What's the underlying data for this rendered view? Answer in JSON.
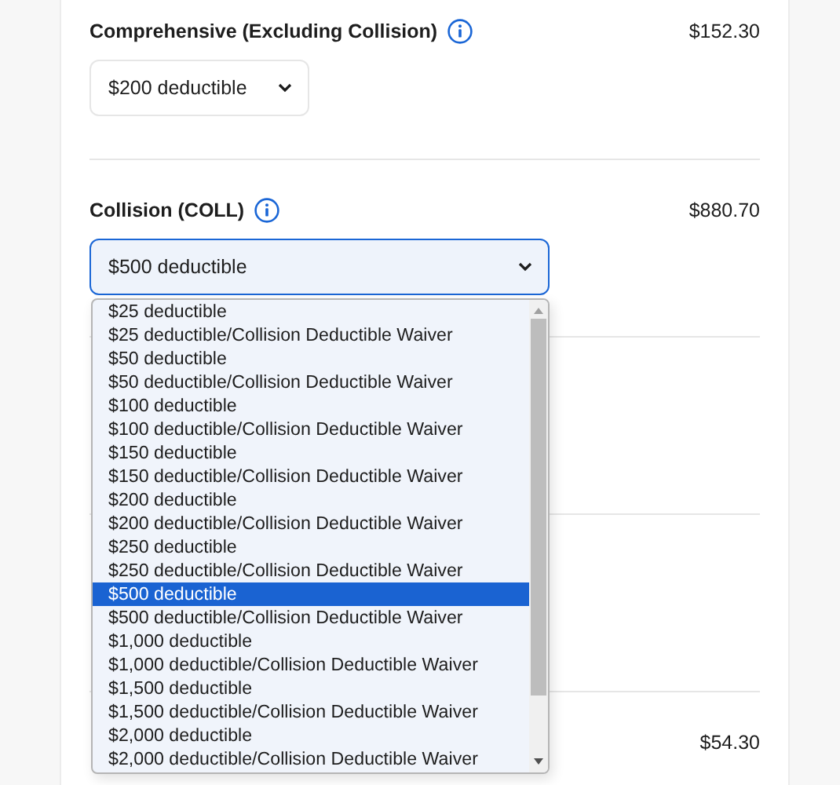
{
  "coverages": [
    {
      "title": "Comprehensive (Excluding Collision)",
      "price": "$152.30",
      "select": {
        "value": "$200 deductible",
        "open": false
      }
    },
    {
      "title": "Collision (COLL)",
      "price": "$880.70",
      "select": {
        "value": "$500 deductible",
        "open": true,
        "options": [
          {
            "label": "$25 deductible",
            "selected": false
          },
          {
            "label": "$25 deductible/Collision Deductible Waiver",
            "selected": false
          },
          {
            "label": "$50 deductible",
            "selected": false
          },
          {
            "label": "$50 deductible/Collision Deductible Waiver",
            "selected": false
          },
          {
            "label": "$100 deductible",
            "selected": false
          },
          {
            "label": "$100 deductible/Collision Deductible Waiver",
            "selected": false
          },
          {
            "label": "$150 deductible",
            "selected": false
          },
          {
            "label": "$150 deductible/Collision Deductible Waiver",
            "selected": false
          },
          {
            "label": "$200 deductible",
            "selected": false
          },
          {
            "label": "$200 deductible/Collision Deductible Waiver",
            "selected": false
          },
          {
            "label": "$250 deductible",
            "selected": false
          },
          {
            "label": "$250 deductible/Collision Deductible Waiver",
            "selected": false
          },
          {
            "label": "$500 deductible",
            "selected": true
          },
          {
            "label": "$500 deductible/Collision Deductible Waiver",
            "selected": false
          },
          {
            "label": "$1,000 deductible",
            "selected": false
          },
          {
            "label": "$1,000 deductible/Collision Deductible Waiver",
            "selected": false
          },
          {
            "label": "$1,500 deductible",
            "selected": false
          },
          {
            "label": "$1,500 deductible/Collision Deductible Waiver",
            "selected": false
          },
          {
            "label": "$2,000 deductible",
            "selected": false
          },
          {
            "label": "$2,000 deductible/Collision Deductible Waiver",
            "selected": false
          }
        ]
      }
    },
    {
      "price": "$54.30"
    }
  ]
}
